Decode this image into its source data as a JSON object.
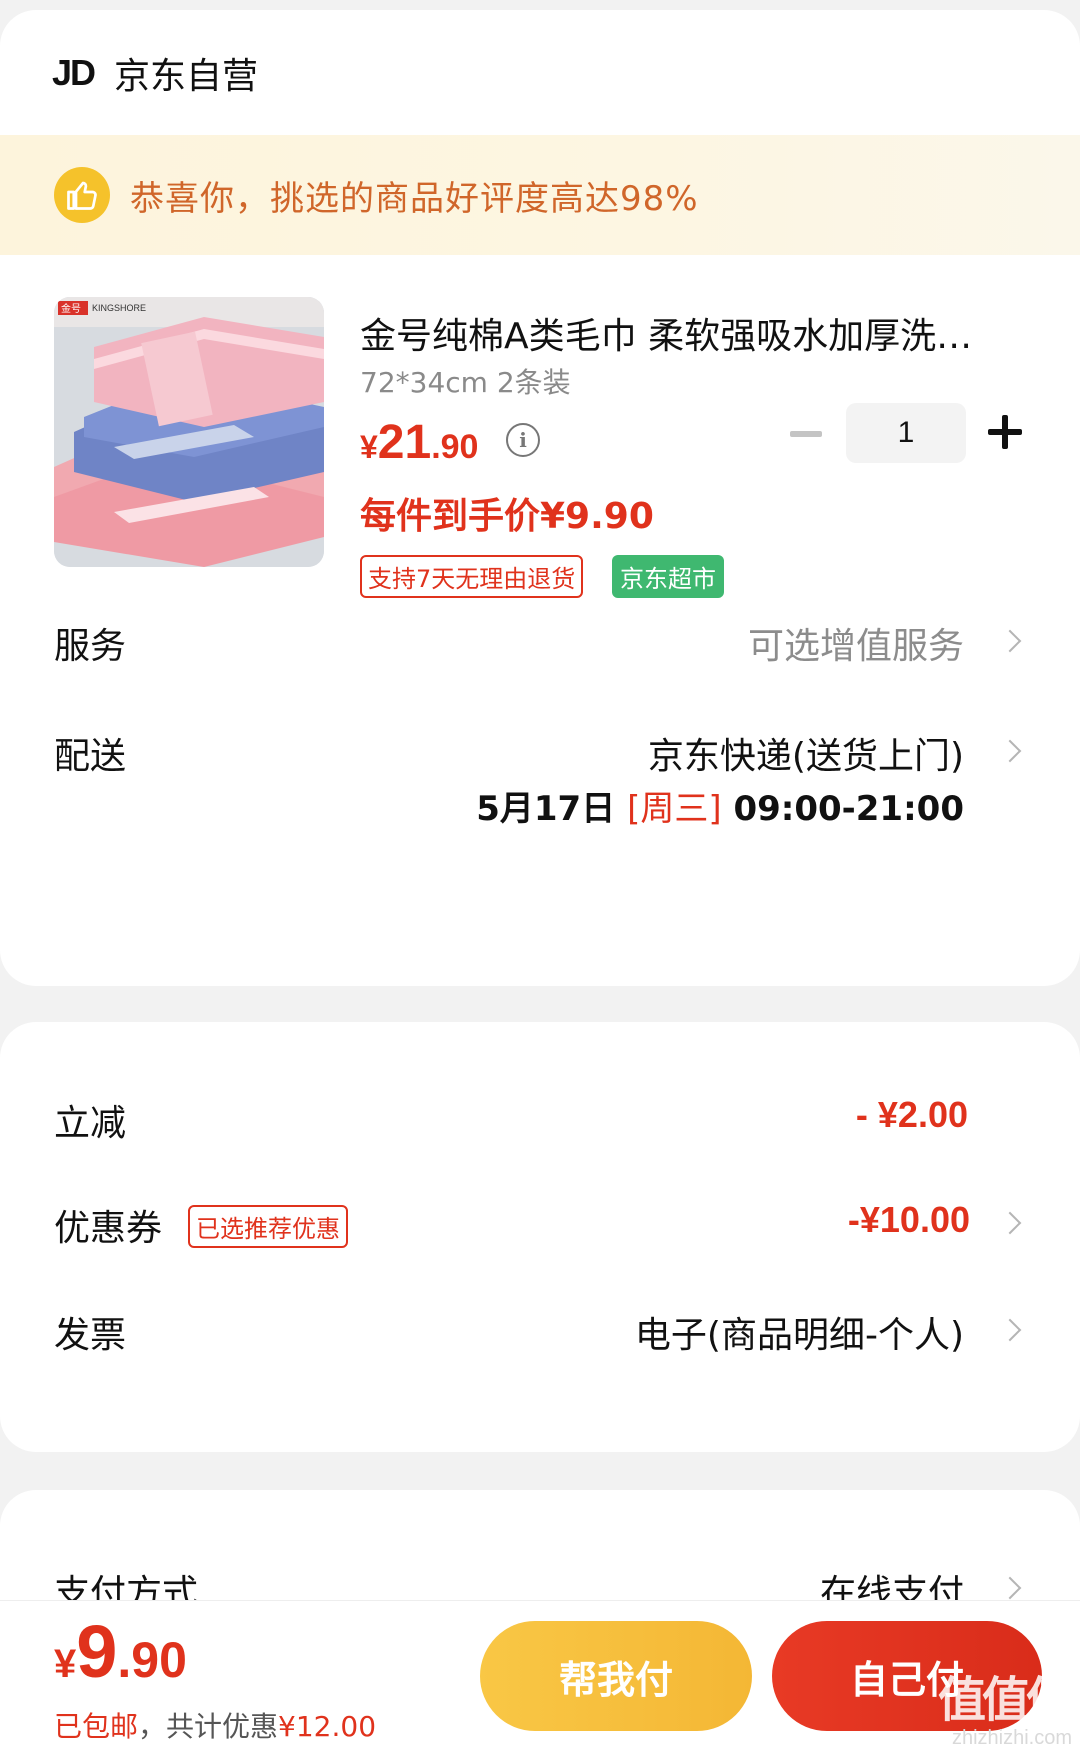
{
  "store": {
    "logo_text": "JD",
    "name": "京东自营"
  },
  "banner": {
    "icon": "thumbs-up-icon",
    "text": "恭喜你，挑选的商品好评度高达98%",
    "color": "#d0662a"
  },
  "product": {
    "title": "金号纯棉A类毛巾 柔软强吸水加厚洗…",
    "spec": "72*34cm 2条装",
    "price": {
      "currency": "¥",
      "integer": "21",
      "decimal": ".90"
    },
    "unit_price": "每件到手价¥9.90",
    "tags": {
      "return": "支持7天无理由退货",
      "market": "京东超市"
    },
    "quantity": "1",
    "image_brand": "金号 KINGSHORE"
  },
  "service": {
    "label": "服务",
    "value": "可选增值服务"
  },
  "delivery": {
    "label": "配送",
    "value": "京东快递(送货上门)",
    "date": "5月17日",
    "weekday": "[周三]",
    "time": "09:00-21:00"
  },
  "discount": {
    "label": "立减",
    "value": "- ¥2.00"
  },
  "coupon": {
    "label": "优惠券",
    "tag": "已选推荐优惠",
    "value": "-¥10.00"
  },
  "invoice": {
    "label": "发票",
    "value": "电子(商品明细-个人)"
  },
  "payment": {
    "label": "支付方式",
    "value": "在线支付"
  },
  "checkout": {
    "total": {
      "currency": "¥",
      "integer": "9",
      "decimal": ".90"
    },
    "shipping": "已包邮",
    "separator": "，共计优惠",
    "saved": "¥12.00",
    "help_pay": "帮我付",
    "self_pay": "自己付"
  },
  "watermark": {
    "text": "值值值",
    "url": "zhizhizhi.com"
  },
  "colors": {
    "accent_red": "#e0321c",
    "green_tag": "#3fb870",
    "yellow_button": "#f6bd3c",
    "banner_bg": "#fdf4dc"
  }
}
